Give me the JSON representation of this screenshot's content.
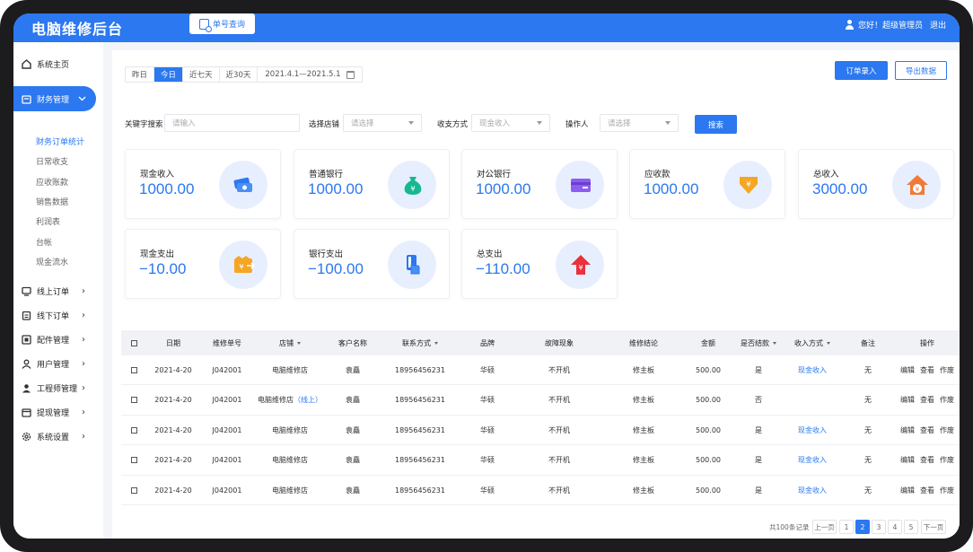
{
  "header": {
    "brand": "电脑维修后台",
    "query_button": "单号查询",
    "greeting": "您好！超级管理员",
    "logout": "退出"
  },
  "sidebar": {
    "home": "系统主页",
    "finance": "财务管理",
    "finance_sub": [
      "财务订单统计",
      "日常收支",
      "应收账款",
      "销售数据",
      "利润表",
      "台帐",
      "现金流水"
    ],
    "groups": [
      "线上订单",
      "线下订单",
      "配件管理",
      "用户管理",
      "工程师管理",
      "提现管理",
      "系统设置"
    ]
  },
  "filters": {
    "tabs": [
      "昨日",
      "今日",
      "近七天",
      "近30天"
    ],
    "date_range": "2021.4.1—2021.5.1",
    "keyword_label": "关键字搜索",
    "keyword_placeholder": "请输入",
    "store_label": "选择店铺",
    "store_placeholder": "请选择",
    "method_label": "收支方式",
    "method_value": "现金收入",
    "operator_label": "操作人",
    "operator_placeholder": "请选择",
    "search_button": "搜索",
    "order_entry_button": "订单录入",
    "export_button": "导出数据"
  },
  "cards": [
    {
      "title": "现金收入",
      "value": "1000.00",
      "icon": "cash-icon"
    },
    {
      "title": "普通银行",
      "value": "1000.00",
      "icon": "money-bag-icon"
    },
    {
      "title": "对公银行",
      "value": "1000.00",
      "icon": "bank-card-icon"
    },
    {
      "title": "应收款",
      "value": "1000.00",
      "icon": "receivable-icon"
    },
    {
      "title": "总收入",
      "value": "3000.00",
      "icon": "house-yuan-icon"
    },
    {
      "title": "现金支出",
      "value": "−10.00",
      "icon": "wallet-out-icon"
    },
    {
      "title": "银行支出",
      "value": "−100.00",
      "icon": "card-swipe-icon"
    },
    {
      "title": "总支出",
      "value": "−110.00",
      "icon": "expense-arrow-icon"
    }
  ],
  "colors": {
    "accent": "#2b78f0"
  },
  "table": {
    "headers": [
      "日期",
      "维修单号",
      "店铺",
      "客户名称",
      "联系方式",
      "品牌",
      "故障现象",
      "维修结论",
      "金额",
      "是否结款",
      "收入方式",
      "备注",
      "操作"
    ],
    "rows": [
      {
        "date": "2021-4-20",
        "order": "J042001",
        "store": "电脑维修店",
        "store_tag": "",
        "customer": "袁矗",
        "phone": "18956456231",
        "brand": "华硕",
        "fault": "不开机",
        "result": "修主板",
        "amount": "500.00",
        "settled": "是",
        "income": "现金收入",
        "note": "无"
      },
      {
        "date": "2021-4-20",
        "order": "J042001",
        "store": "电脑维修店",
        "store_tag": "（线上）",
        "customer": "袁矗",
        "phone": "18956456231",
        "brand": "华硕",
        "fault": "不开机",
        "result": "修主板",
        "amount": "500.00",
        "settled": "否",
        "income": "",
        "note": "无"
      },
      {
        "date": "2021-4-20",
        "order": "J042001",
        "store": "电脑维修店",
        "store_tag": "",
        "customer": "袁矗",
        "phone": "18956456231",
        "brand": "华硕",
        "fault": "不开机",
        "result": "修主板",
        "amount": "500.00",
        "settled": "是",
        "income": "现金收入",
        "note": "无"
      },
      {
        "date": "2021-4-20",
        "order": "J042001",
        "store": "电脑维修店",
        "store_tag": "",
        "customer": "袁矗",
        "phone": "18956456231",
        "brand": "华硕",
        "fault": "不开机",
        "result": "修主板",
        "amount": "500.00",
        "settled": "是",
        "income": "现金收入",
        "note": "无"
      },
      {
        "date": "2021-4-20",
        "order": "J042001",
        "store": "电脑维修店",
        "store_tag": "",
        "customer": "袁矗",
        "phone": "18956456231",
        "brand": "华硕",
        "fault": "不开机",
        "result": "修主板",
        "amount": "500.00",
        "settled": "是",
        "income": "现金收入",
        "note": "无"
      }
    ],
    "actions": [
      "编辑",
      "查看",
      "作废"
    ]
  },
  "pagination": {
    "total": "共100条记录",
    "prev": "上一页",
    "pages": [
      "1",
      "2",
      "3",
      "4",
      "5"
    ],
    "current": "2",
    "next": "下一页"
  }
}
